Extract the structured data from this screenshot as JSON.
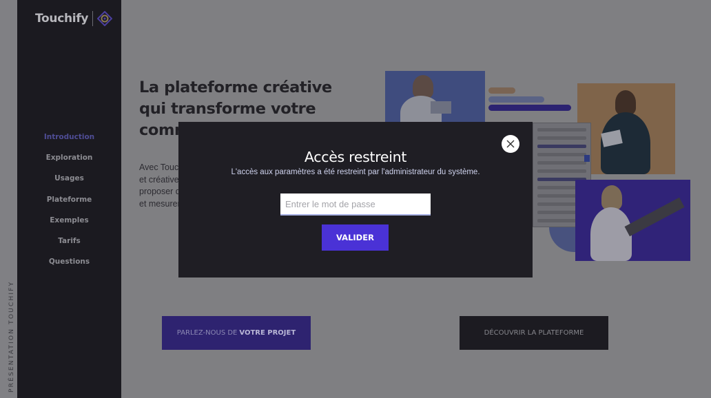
{
  "brand": {
    "name": "Touchify",
    "accent": "#4a32d6"
  },
  "vertical_label": "PRÉSENTATION TOUCHIFY",
  "nav": {
    "items": [
      {
        "label": "Introduction",
        "active": true
      },
      {
        "label": "Exploration"
      },
      {
        "label": "Usages"
      },
      {
        "label": "Plateforme"
      },
      {
        "label": "Exemples"
      },
      {
        "label": "Tarifs"
      },
      {
        "label": "Questions"
      }
    ]
  },
  "hero": {
    "title_lines": [
      "La plateforme créative",
      "qui transforme votre",
      "comm"
    ],
    "desc_lines": [
      "Avec Touch",
      "et créative",
      "proposer d",
      "et mesurer"
    ]
  },
  "cta": {
    "project_prefix": "PARLEZ-NOUS DE",
    "project_strong": "VOTRE PROJET",
    "discover": "DÉCOUVRIR LA PLATEFORME"
  },
  "modal": {
    "title": "Accès restreint",
    "subtitle": "L'accès aux paramètres a été restreint par l'administrateur du système.",
    "password_placeholder": "Entrer le mot de passe",
    "password_value": "",
    "submit_label": "VALIDER",
    "close_icon": "close-icon"
  }
}
